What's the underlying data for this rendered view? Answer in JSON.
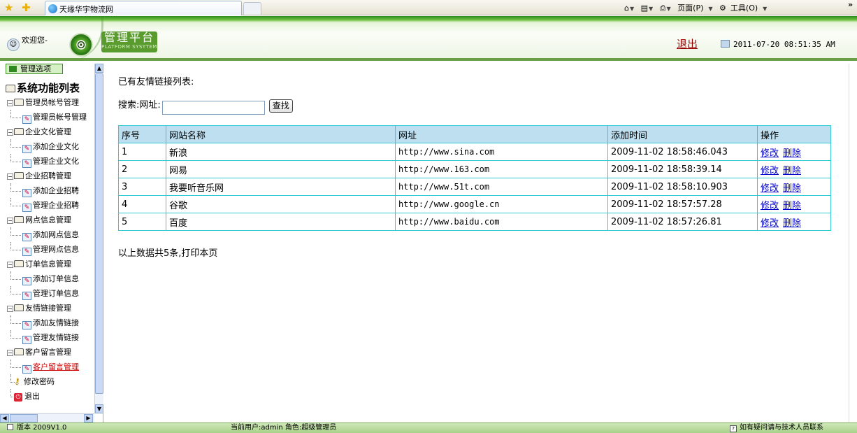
{
  "browser": {
    "tab_title": "天缘华宇物流网",
    "home_label": "",
    "page_menu": "页面(P)",
    "tools_menu": "工具(O)",
    "more": "»"
  },
  "header": {
    "welcome": "欢迎您-",
    "logo_letter": "⊙",
    "platform_title": "管理平台",
    "platform_subtitle": "PLATFORM SYSYTEM",
    "logout": "退出",
    "datetime": "2011-07-20 08:51:35 AM"
  },
  "sidebar": {
    "menu_tab": "管理选项",
    "root": "系统功能列表",
    "groups": [
      {
        "label": "管理员帐号管理",
        "items": [
          "管理员帐号管理"
        ]
      },
      {
        "label": "企业文化管理",
        "items": [
          "添加企业文化",
          "管理企业文化"
        ]
      },
      {
        "label": "企业招聘管理",
        "items": [
          "添加企业招聘",
          "管理企业招聘"
        ]
      },
      {
        "label": "网点信息管理",
        "items": [
          "添加网点信息",
          "管理网点信息"
        ]
      },
      {
        "label": "订单信息管理",
        "items": [
          "添加订单信息",
          "管理订单信息"
        ]
      },
      {
        "label": "友情链接管理",
        "items": [
          "添加友情链接",
          "管理友情链接"
        ]
      },
      {
        "label": "客户留言管理",
        "items": [
          "客户留言管理"
        ]
      }
    ],
    "change_password": "修改密码",
    "exit": "退出"
  },
  "main": {
    "heading": "已有友情链接列表:",
    "search_label": "搜索:网址:",
    "search_value": "",
    "search_button": "查找",
    "columns": [
      "序号",
      "网站名称",
      "网址",
      "添加时间",
      "操作"
    ],
    "rows": [
      {
        "id": "1",
        "name": "新浪",
        "url": "http://www.sina.com",
        "time": "2009-11-02 18:58:46.043"
      },
      {
        "id": "2",
        "name": "网易",
        "url": "http://www.163.com",
        "time": "2009-11-02 18:58:39.14"
      },
      {
        "id": "3",
        "name": "我要听音乐网",
        "url": "http://www.51t.com",
        "time": "2009-11-02 18:58:10.903"
      },
      {
        "id": "4",
        "name": "谷歌",
        "url": "http://www.google.cn",
        "time": "2009-11-02 18:57:57.28"
      },
      {
        "id": "5",
        "name": "百度",
        "url": "http://www.baidu.com",
        "time": "2009-11-02 18:57:26.81"
      }
    ],
    "edit_label": "修改",
    "delete_label": "删除",
    "footer_text": "以上数据共5条,打印本页"
  },
  "status": {
    "version": "版本 2009V1.0",
    "current_user": "当前用户:admin  角色:超级管理员",
    "help": "如有疑问请与技术人员联系"
  }
}
